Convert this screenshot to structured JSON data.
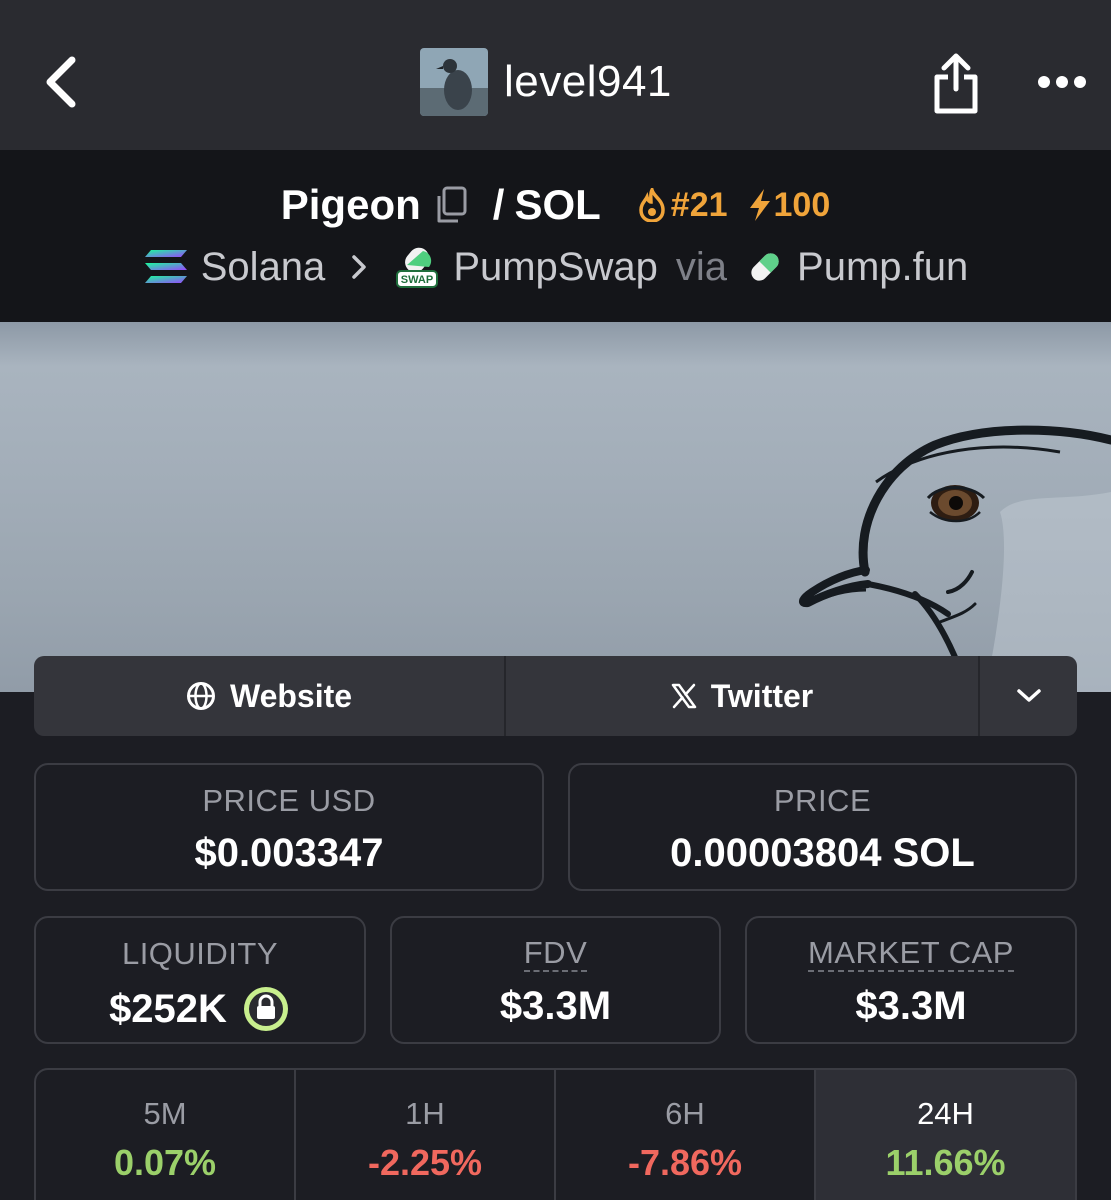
{
  "nav": {
    "username": "level941"
  },
  "token": {
    "base": "Pigeon",
    "separator": "/",
    "quote": "SOL",
    "rank": "#21",
    "boost": "100"
  },
  "route": {
    "chain": "Solana",
    "dex": "PumpSwap",
    "via": "via",
    "launchpad": "Pump.fun",
    "dex_badge": "SWAP"
  },
  "links": {
    "website": "Website",
    "twitter": "Twitter"
  },
  "stats": {
    "price_usd_label": "PRICE USD",
    "price_usd": "$0.003347",
    "price_label": "PRICE",
    "price": "0.00003804 SOL",
    "liquidity_label": "LIQUIDITY",
    "liquidity": "$252K",
    "fdv_label": "FDV",
    "fdv": "$3.3M",
    "mcap_label": "MARKET CAP",
    "mcap": "$3.3M"
  },
  "timeframes": [
    {
      "label": "5M",
      "value": "0.07%",
      "trend": "up"
    },
    {
      "label": "1H",
      "value": "-2.25%",
      "trend": "down"
    },
    {
      "label": "6H",
      "value": "-7.86%",
      "trend": "down"
    },
    {
      "label": "24H",
      "value": "11.66%",
      "trend": "up",
      "active": true
    }
  ],
  "colors": {
    "positive": "#9bd06a",
    "negative": "#f0685e",
    "accent": "#f0a43a"
  }
}
